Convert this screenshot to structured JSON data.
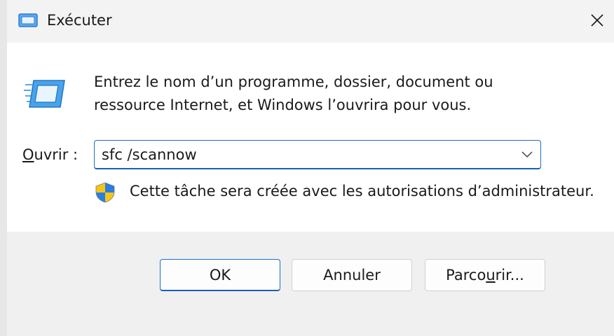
{
  "window": {
    "title": "Exécuter",
    "title_icon": "run-icon",
    "close_icon": "close-icon"
  },
  "content": {
    "icon": "run-icon",
    "description_line1": "Entrez le nom d’un programme, dossier, document ou",
    "description_line2": "ressource Internet, et Windows l’ouvrira pour vous.",
    "open_label_mnemonic": "O",
    "open_label_rest": "uvrir :",
    "open_value": "sfc /scannow",
    "dropdown_icon": "chevron-down-icon",
    "shield_icon": "uac-shield-icon",
    "admin_note": "Cette tâche sera créée avec les autorisations d’administrateur."
  },
  "buttons": {
    "ok_label": "OK",
    "cancel_label": "Annuler",
    "browse_label_before": "Parco",
    "browse_label_mnemonic": "u",
    "browse_label_after": "rir..."
  },
  "colors": {
    "accent": "#1f6ec8",
    "content_bg": "#ffffff",
    "footer_bg": "#f0f0f0",
    "shield_blue": "#2a7de1",
    "shield_yellow": "#f5c518"
  }
}
